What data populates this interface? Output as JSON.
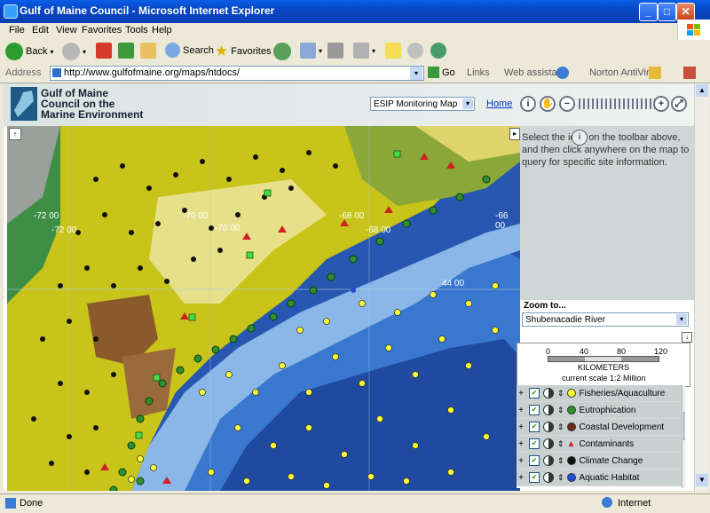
{
  "window": {
    "title": "Gulf of Maine Council - Microsoft Internet Explorer"
  },
  "menu": [
    "File",
    "Edit",
    "View",
    "Favorites",
    "Tools",
    "Help"
  ],
  "toolbar": {
    "back_label": "Back",
    "search_label": "Search",
    "favorites_label": "Favorites"
  },
  "addressbar": {
    "label": "Address",
    "url": "http://www.gulfofmaine.org/maps/htdocs/",
    "go_label": "Go",
    "links_label": "Links",
    "web_assistant_label": "Web assistant",
    "antivirus_label": "Norton AntiVirus"
  },
  "page": {
    "logo_text": "Gulf of Maine Council on the Marine Environment",
    "map_select_value": "ESIP Monitoring Map",
    "home_label": "Home",
    "info_text": "Select the   icon on the toolbar above, and then click anywhere on the map to query for specific site information.",
    "info_icon_glyph": "i",
    "zoom_label": "Zoom to...",
    "zoom_value": "Shubenacadie River",
    "scale": {
      "ticks": [
        "0",
        "40",
        "80",
        "120"
      ],
      "unit": "KILOMETERS",
      "current": "current scale 1:2 Million"
    },
    "map_labels": {
      "lon_72a": "-72 00",
      "lon_72b": "-72 00",
      "lon_70a": "-70 00",
      "lon_70b": "-70 00",
      "lon_68a": "-68 00",
      "lon_68b": "-68 00",
      "lon_66": "-66 00",
      "lat_44": "44 00"
    },
    "layers": [
      {
        "label": "Fisheries/Aquaculture",
        "marker": "yellow-circle",
        "color": "#ffff33"
      },
      {
        "label": "Eutrophication",
        "marker": "green-circle",
        "color": "#2f8f2f"
      },
      {
        "label": "Coastal Development",
        "marker": "brown-circle",
        "color": "#6b2a1a"
      },
      {
        "label": "Contaminants",
        "marker": "red-triangle",
        "color": "#cc2222"
      },
      {
        "label": "Climate Change",
        "marker": "black-circle",
        "color": "#111111"
      },
      {
        "label": "Aquatic Habitat",
        "marker": "blue-circle",
        "color": "#1f4fd0"
      }
    ]
  },
  "status": {
    "left": "Done",
    "zone": "Internet"
  }
}
